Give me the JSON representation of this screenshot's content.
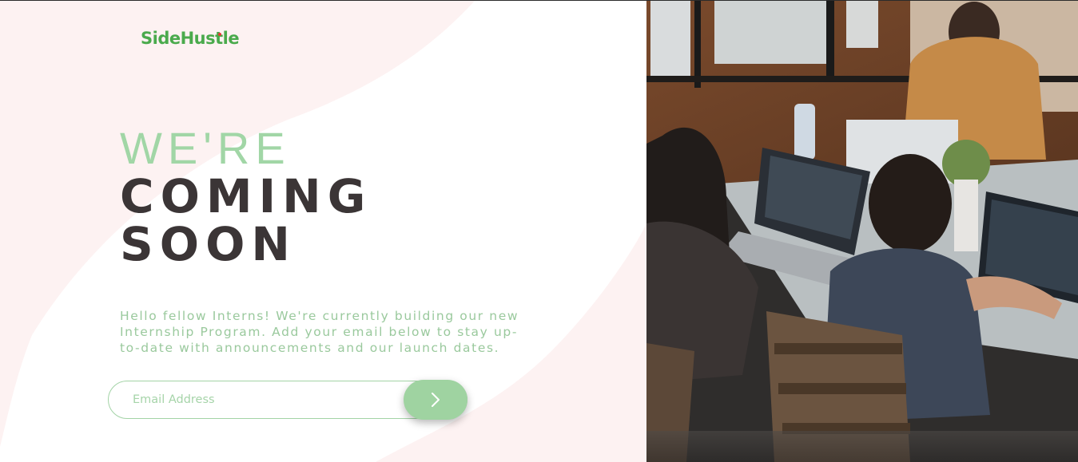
{
  "brand": {
    "logo_text": "SideHustle"
  },
  "hero": {
    "line1": "WE'RE",
    "line2": "COMING",
    "line3": "SOON",
    "intro": "Hello fellow Interns! We're currently building our new Internship Program. Add your email below to stay up-to-date with announcements and our launch dates."
  },
  "signup": {
    "email_placeholder": "Email Address",
    "email_value": ""
  },
  "icons": {
    "submit": "chevron-right-icon"
  },
  "colors": {
    "accent_green": "#9fd3a1",
    "logo_green": "#4aaa4c",
    "headline_dark": "#3b3536",
    "background_pink": "#fdf1f1"
  }
}
